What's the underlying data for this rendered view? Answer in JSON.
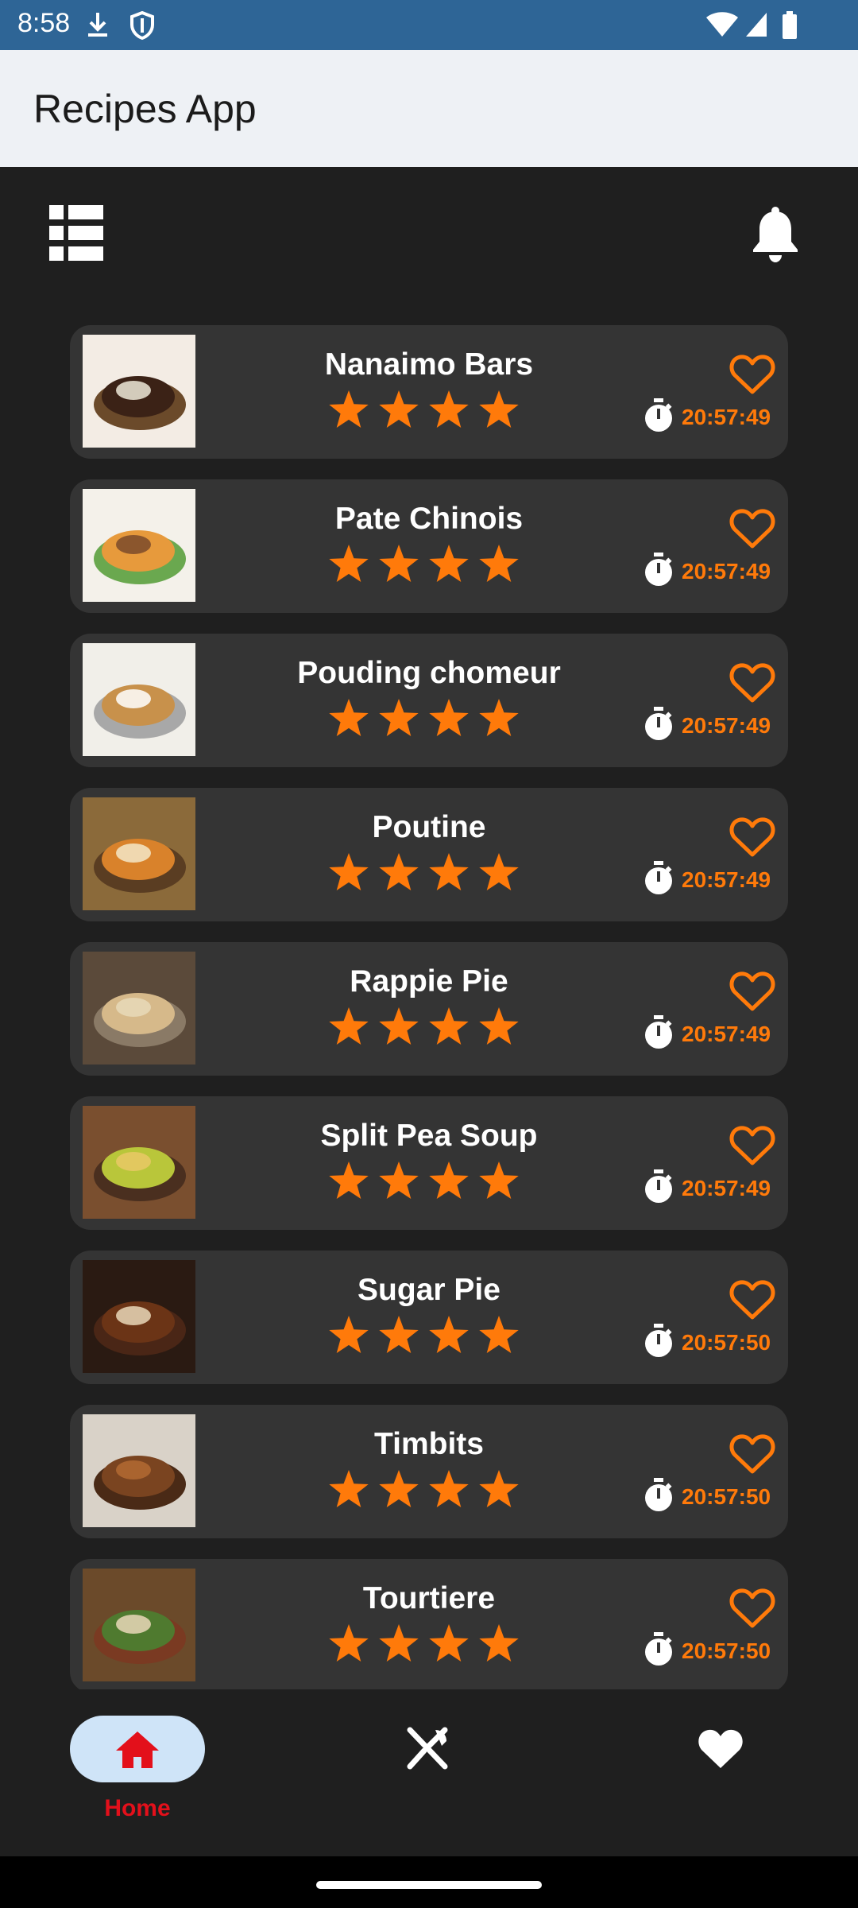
{
  "status_bar": {
    "time": "8:58",
    "icons": [
      "download-icon",
      "shield-icon",
      "wifi-icon",
      "signal-icon",
      "battery-icon"
    ]
  },
  "app_bar": {
    "title": "Recipes App"
  },
  "toolbar": {
    "icons": [
      "grid-view-icon",
      "bell-icon"
    ]
  },
  "colors": {
    "accent": "#ff7a0a",
    "card": "#343434",
    "background": "#1f1f1f",
    "status_bar": "#2e6596",
    "nav_active": "#e3101b"
  },
  "recipes": [
    {
      "name": "Nanaimo Bars",
      "rating": 4,
      "time": "20:57:49"
    },
    {
      "name": "Pate Chinois",
      "rating": 4,
      "time": "20:57:49"
    },
    {
      "name": "Pouding chomeur",
      "rating": 4,
      "time": "20:57:49"
    },
    {
      "name": "Poutine",
      "rating": 4,
      "time": "20:57:49"
    },
    {
      "name": "Rappie Pie",
      "rating": 4,
      "time": "20:57:49"
    },
    {
      "name": "Split Pea Soup",
      "rating": 4,
      "time": "20:57:49"
    },
    {
      "name": "Sugar Pie",
      "rating": 4,
      "time": "20:57:50"
    },
    {
      "name": "Timbits",
      "rating": 4,
      "time": "20:57:50"
    },
    {
      "name": "Tourtiere",
      "rating": 4,
      "time": "20:57:50"
    }
  ],
  "bottom_nav": {
    "home_label": "Home",
    "items": [
      "home-icon",
      "utensils-icon",
      "heart-icon"
    ]
  }
}
